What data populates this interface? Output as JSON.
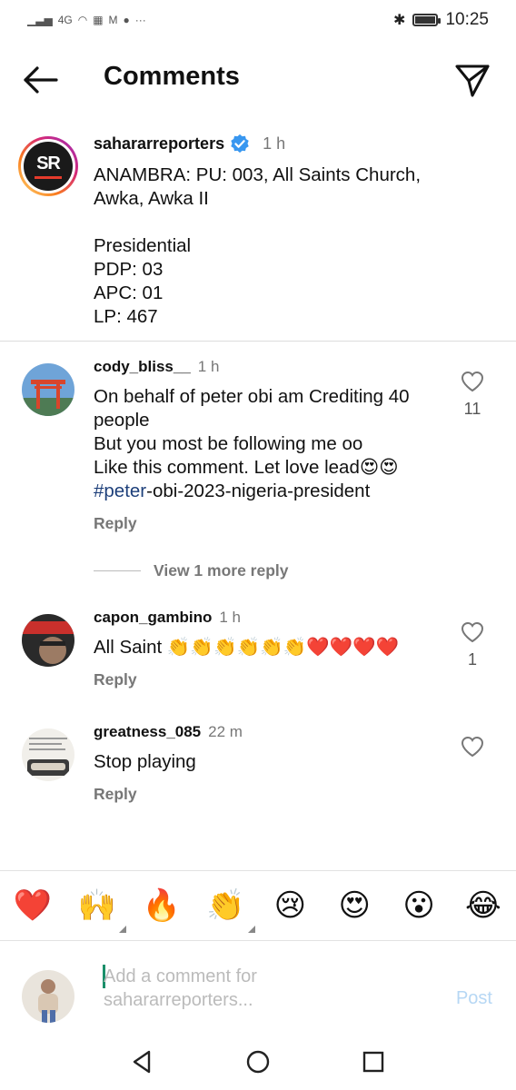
{
  "status_bar": {
    "signal_left": "4G",
    "time": "10:25",
    "battery_level": 0.9
  },
  "header": {
    "title": "Comments",
    "back_icon": "arrow-left-icon",
    "share_icon": "paper-plane-icon"
  },
  "caption": {
    "username": "sahararreporters",
    "time": "1 h",
    "avatar_text": "SR",
    "lines": [
      "ANAMBRA: PU: 003, All Saints Church,",
      "Awka, Awka II",
      "",
      "Presidential",
      "PDP: 03",
      "APC: 01",
      "LP: 467"
    ]
  },
  "comments": [
    {
      "username": "cody_bliss__",
      "time": "1 h",
      "lines": [
        "On behalf of peter obi am Crediting 40",
        "people",
        "But you most be following me oo",
        "Like this comment. Let love lead😍😍"
      ],
      "hashtag": "#peter",
      "hashtag_rest": "-obi-2023-nigeria-president",
      "reply": "Reply",
      "likes": "11"
    },
    {
      "username": "capon_gambino",
      "time": "1 h",
      "text": "All Saint 👏👏👏👏👏👏❤️❤️❤️❤️",
      "reply": "Reply",
      "likes": "1"
    },
    {
      "username": "greatness_085",
      "time": "22 m",
      "text": "Stop playing",
      "reply": "Reply",
      "likes": ""
    }
  ],
  "view_more": "View 1 more reply",
  "emoji_bar": [
    "❤️",
    "🙌",
    "🔥",
    "👏",
    "😢",
    "😍",
    "😮",
    "😂"
  ],
  "compose": {
    "placeholder_line1": "Add a comment for",
    "placeholder_line2": "sahararreporters...",
    "post_label": "Post"
  }
}
